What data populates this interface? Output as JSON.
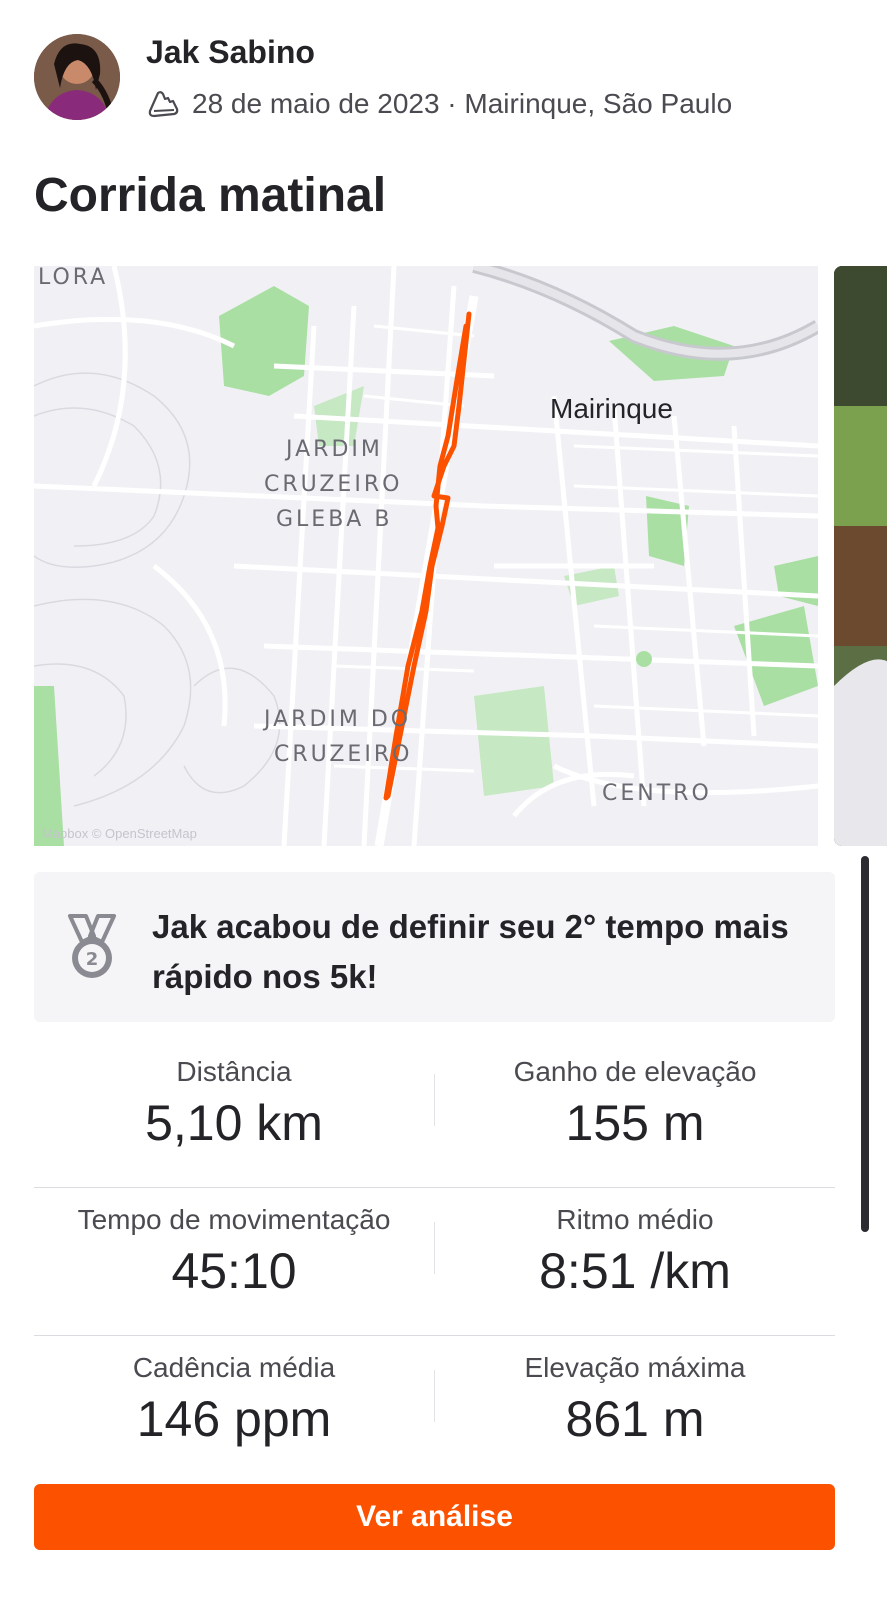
{
  "header": {
    "athlete_name": "Jak Sabino",
    "meta": "28 de maio de 2023 · Mairinque, São Paulo",
    "activity_icon": "running-shoe-icon"
  },
  "activity": {
    "title": "Corrida matinal"
  },
  "map": {
    "labels": {
      "flora": "LORA",
      "mairinque": "Mairinque",
      "jardim_cruzeiro_gleba_b_1": "JARDIM",
      "jardim_cruzeiro_gleba_b_2": "CRUZEIRO",
      "jardim_cruzeiro_gleba_b_3": "GLEBA B",
      "jardim_do_cruzeiro_1": "JARDIM DO",
      "jardim_do_cruzeiro_2": "CRUZEIRO",
      "centro": "CENTRO",
      "attribution": "Mapbox © OpenStreetMap"
    },
    "route_color": "#fc5200"
  },
  "achievement": {
    "icon": "medal-2-icon",
    "text": "Jak acabou de definir seu 2° tempo mais rápido nos 5k!"
  },
  "stats": {
    "distance_label": "Distância",
    "distance_value": "5,10 km",
    "elevation_gain_label": "Ganho de elevação",
    "elevation_gain_value": "155 m",
    "moving_time_label": "Tempo de movimentação",
    "moving_time_value": "45:10",
    "pace_label": "Ritmo médio",
    "pace_value": "8:51 /km",
    "cadence_label": "Cadência média",
    "cadence_value": "146 ppm",
    "max_elevation_label": "Elevação máxima",
    "max_elevation_value": "861 m"
  },
  "cta": {
    "label": "Ver análise"
  },
  "colors": {
    "brand": "#fc5200",
    "text": "#242428",
    "muted": "#4a4a50",
    "panel": "#f5f5f7"
  }
}
